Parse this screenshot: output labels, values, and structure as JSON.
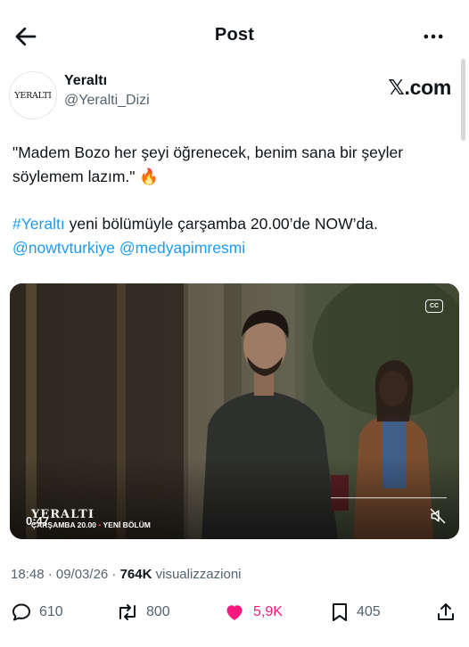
{
  "topbar": {
    "title": "Post"
  },
  "author": {
    "name": "Yeraltı",
    "handle": "@Yeralti_Dizi",
    "avatar_text": "YERALTI",
    "platform_badge": "𝕏.com"
  },
  "tweet": {
    "line1": "\"Madem Bozo her şeyi öğrenecek, benim sana bir şeyler",
    "line2": "söylemem lazım.\" 🔥",
    "hashtag": "#Yeraltı",
    "line3_rest": " yeni bölümüyle çarşamba 20.00’de NOW’da.",
    "mention1": "@nowtvturkiye",
    "mention2": "@medyapimresmi"
  },
  "video": {
    "timestamp": "0:47",
    "overlay_title": "YERALTI",
    "overlay_sub1": "ÇARŞAMBA 20.00",
    "overlay_sep": "•",
    "overlay_sub2": "YENİ BÖLÜM",
    "cc_label": "CC"
  },
  "meta": {
    "time": "18:48 · 09/03/26 · ",
    "views": "764K",
    "views_label": " visualizzazioni"
  },
  "actions": {
    "replies": "610",
    "reposts": "800",
    "likes": "5,9K",
    "bookmarks": "405"
  },
  "colors": {
    "accent": "#1d9bf0",
    "like": "#f91880",
    "muted": "#536471"
  }
}
